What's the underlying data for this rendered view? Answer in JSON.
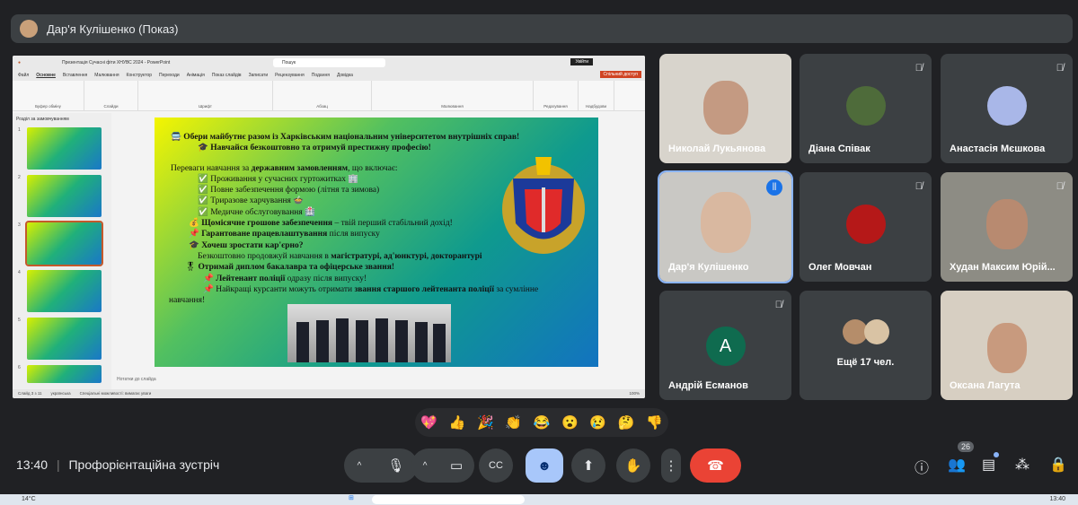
{
  "header": {
    "presenter": "Дар'я Кулішенко (Показ)"
  },
  "ppt": {
    "title": "Презентація Сучасні фіти ХНУВС 2024 - PowerPoint",
    "search": "Пошук",
    "sign_in": "Увійти",
    "share": "Спільний доступ",
    "tabs": [
      "Файл",
      "Основне",
      "Вставлення",
      "Малювання",
      "Конструктор",
      "Переходи",
      "Анімація",
      "Показ слайдів",
      "Записати",
      "Рецензування",
      "Подання",
      "Довідка"
    ],
    "ribbon_groups": [
      "Буфер обміну",
      "Слайди",
      "Шрифт",
      "Абзац",
      "Малювання",
      "Редагування",
      "Надбудови"
    ],
    "section": "Розділ за замовчуванням",
    "thumb_numbers": [
      "1",
      "2",
      "3",
      "4",
      "5",
      "6"
    ],
    "notes": "Нотатки до слайда",
    "status": [
      "Слайд 3 з 11",
      "українська",
      "Спеціальні можливості: вимагає уваги"
    ],
    "zoom": "100%"
  },
  "slide": {
    "l1": "Обери майбутнє разом із Харківським національним університетом внутрішніх справ!",
    "l2": "Навчайся безкоштовно та отримуй престижну професію!",
    "l3a": "Переваги навчання за ",
    "l3b": "державним замовленням",
    "l3c": ", що включає:",
    "checks": [
      "Проживання у сучасних гуртожитках",
      "Повне забезпечення формою (літня та зимова)",
      "Триразове харчування",
      "Медичне обслуговування"
    ],
    "l4a": "Щомісячне грошове забезпечення",
    "l4b": " – твій перший стабільний дохід!",
    "l5a": "Гарантоване працевлаштування",
    "l5b": " після випуску",
    "l6": "Хочеш зростати кар'єрно?",
    "l7a": "Безкоштовно продовжуй навчання в ",
    "l7b": "магістратурі, ад'юнктурі, докторантурі",
    "l8": "Отримай диплом бакалавра та офіцерське звання!",
    "l9a": "Лейтенант поліції",
    "l9b": " одразу після випуску!",
    "l10a": "Найкращі курсанти можуть отримати ",
    "l10b": "звання старшого лейтенанта поліції",
    "l10c": " за сумлінне",
    "l11": "навчання!",
    "emblem": "ХАРКІВСЬКИЙ НАЦІОНАЛЬНИЙ УНІВЕРСИТЕТ ВНУТРІШНІХ СПРАВ"
  },
  "participants": [
    {
      "name": "Николай Лукьянова",
      "muted": false
    },
    {
      "name": "Діана Співак",
      "muted": true
    },
    {
      "name": "Анастасія Мєшкова",
      "muted": true
    },
    {
      "name": "Дар'я Кулішенко",
      "muted": false
    },
    {
      "name": "Олег Мовчан",
      "muted": true
    },
    {
      "name": "Худан Максим Юрій...",
      "muted": true
    },
    {
      "name": "Андрій Есманов",
      "muted": true,
      "initial": "A"
    },
    {
      "name": "Ещё 17 чел.",
      "muted": false
    },
    {
      "name": "Оксана Лагута",
      "muted": false
    }
  ],
  "reactions": [
    "💖",
    "👍",
    "🎉",
    "👏",
    "😂",
    "😮",
    "😢",
    "🤔",
    "👎"
  ],
  "bottom": {
    "time": "13:40",
    "meeting": "Профорієнтаційна зустріч",
    "people_count": "26"
  },
  "taskbar": {
    "weather": "14°C",
    "clock": "13:40"
  },
  "colors": {
    "bg": "#202124",
    "tile": "#3c4043",
    "end_call": "#ea4335",
    "active": "#a8c7fa"
  }
}
